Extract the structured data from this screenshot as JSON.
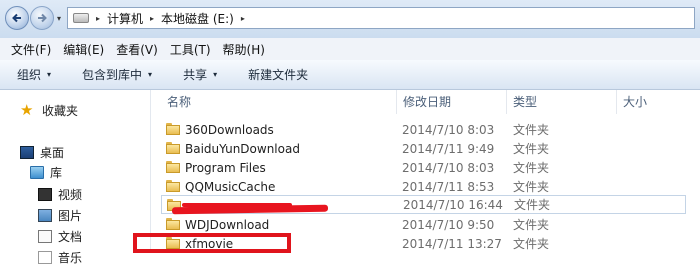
{
  "address_bar": {
    "crumbs": [
      "计算机",
      "本地磁盘 (E:)"
    ],
    "separator": "▸",
    "recent_caret": "▾"
  },
  "menu": [
    "文件(F)",
    "编辑(E)",
    "查看(V)",
    "工具(T)",
    "帮助(H)"
  ],
  "commands": [
    {
      "label": "组织",
      "caret": "▾"
    },
    {
      "label": "包含到库中",
      "caret": "▾"
    },
    {
      "label": "共享",
      "caret": "▾"
    },
    {
      "label": "新建文件夹",
      "caret": ""
    }
  ],
  "nav": {
    "favorites": "收藏夹",
    "desktop": "桌面",
    "libraries": "库",
    "videos": "视频",
    "pictures": "图片",
    "documents": "文档",
    "music": "音乐"
  },
  "columns": {
    "name": "名称",
    "date": "修改日期",
    "type": "类型",
    "size": "大小"
  },
  "files": [
    {
      "name": "360Downloads",
      "date": "2014/7/10 8:03",
      "type": "文件夹"
    },
    {
      "name": "BaiduYunDownload",
      "date": "2014/7/11 9:49",
      "type": "文件夹"
    },
    {
      "name": "Program Files",
      "date": "2014/7/10 8:03",
      "type": "文件夹"
    },
    {
      "name": "QQMusicCache",
      "date": "2014/7/11 8:53",
      "type": "文件夹"
    },
    {
      "name": "",
      "date": "2014/7/10 16:44",
      "type": "文件夹"
    },
    {
      "name": "WDJDownload",
      "date": "2014/7/10 9:50",
      "type": "文件夹"
    },
    {
      "name": "xfmovie",
      "date": "2014/7/11 13:27",
      "type": "文件夹"
    }
  ],
  "colors": {
    "annotation": "#e0141c",
    "header_text": "#4c607a"
  },
  "icons": {
    "back": "back-arrow-icon",
    "forward": "forward-arrow-icon",
    "folder": "folder-icon",
    "favorites": "star-icon"
  }
}
